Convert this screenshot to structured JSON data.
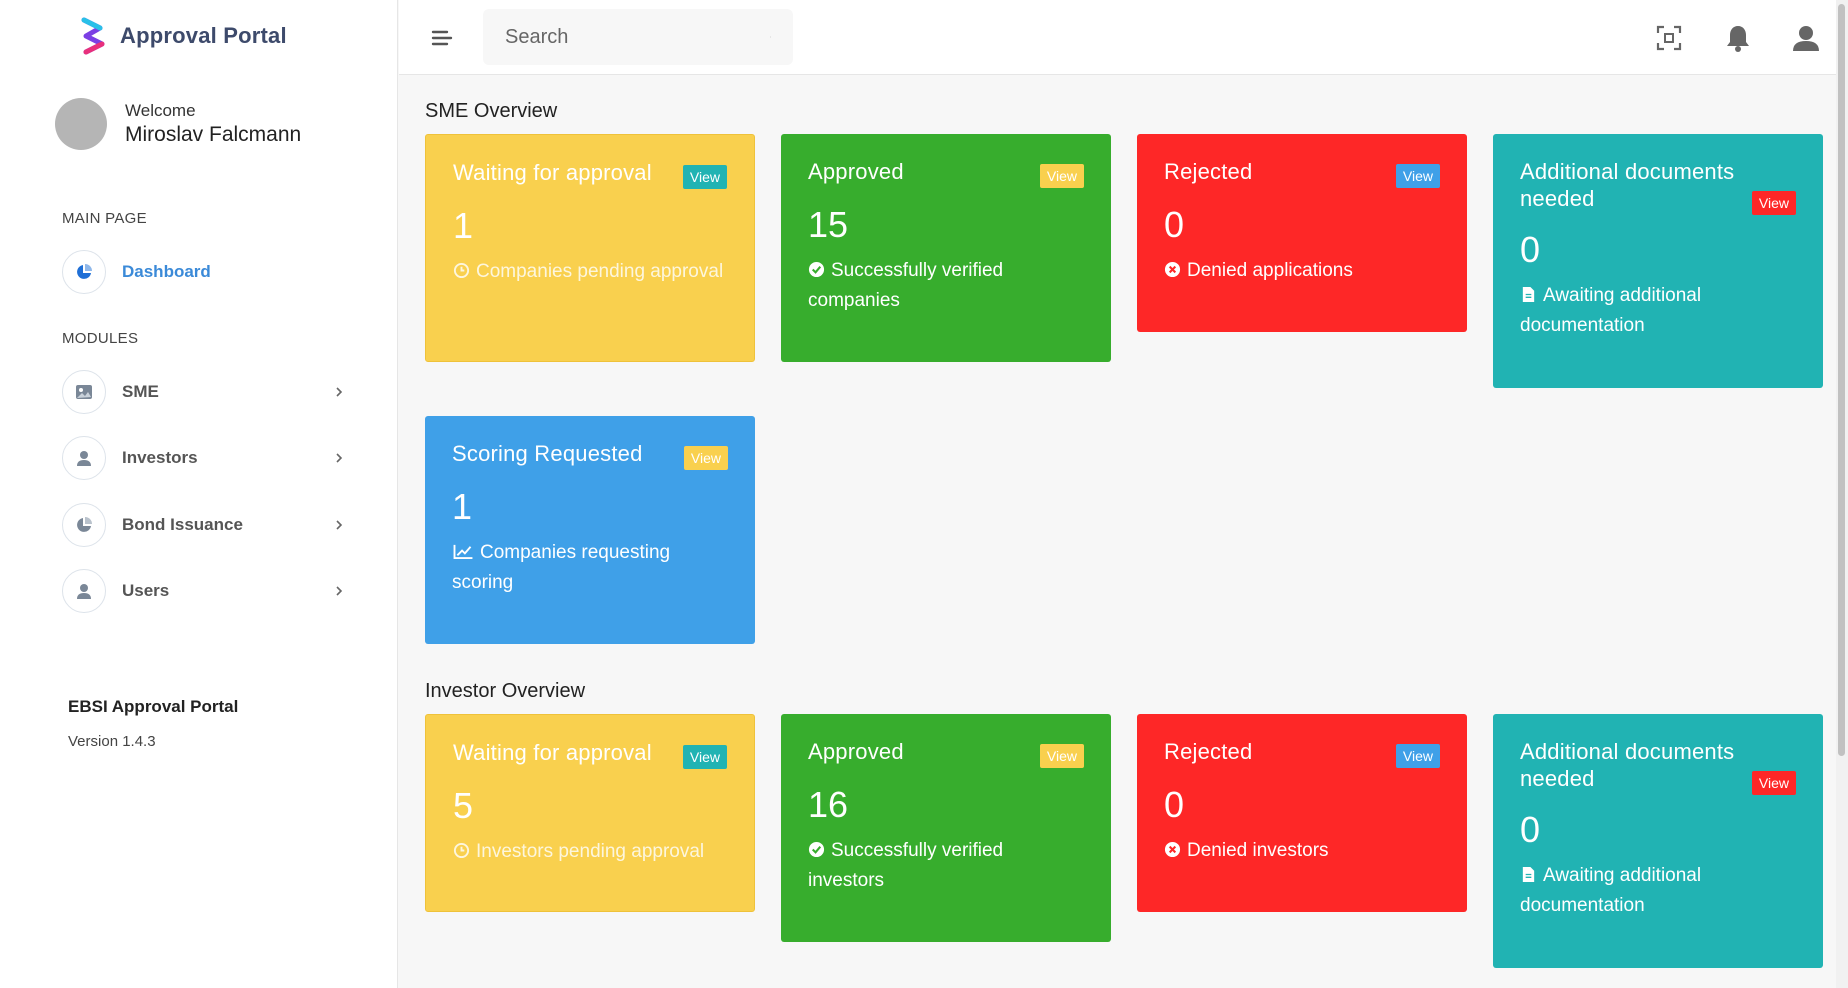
{
  "brand": {
    "name": "Approval Portal"
  },
  "user": {
    "welcome": "Welcome",
    "name": "Miroslav Falcmann"
  },
  "sidebar": {
    "main_label": "MAIN PAGE",
    "modules_label": "MODULES",
    "items": [
      {
        "label": "Dashboard",
        "icon": "pie-chart-icon",
        "active": true
      },
      {
        "label": "SME",
        "icon": "image-icon"
      },
      {
        "label": "Investors",
        "icon": "user-icon"
      },
      {
        "label": "Bond Issuance",
        "icon": "pie-chart-icon"
      },
      {
        "label": "Users",
        "icon": "user-icon"
      }
    ],
    "footer_title": "EBSI Approval Portal",
    "footer_version": "Version 1.4.3"
  },
  "topbar": {
    "search_placeholder": "Search"
  },
  "colors": {
    "yellow": "#f9d04e",
    "green": "#37ad2d",
    "red": "#fe2727",
    "teal": "#21b3b3",
    "blue": "#3fa0e8",
    "active": "#3b8ad8"
  },
  "sme": {
    "title": "SME Overview",
    "waiting": {
      "title": "Waiting for approval",
      "view": "View",
      "value": "1",
      "desc": "Companies pending approval"
    },
    "approved": {
      "title": "Approved",
      "view": "View",
      "value": "15",
      "desc": "Successfully verified companies"
    },
    "rejected": {
      "title": "Rejected",
      "view": "View",
      "value": "0",
      "desc": "Denied applications"
    },
    "additional": {
      "title": "Additional documents needed",
      "view": "View",
      "value": "0",
      "desc": "Awaiting additional documentation"
    },
    "scoring": {
      "title": "Scoring Requested",
      "view": "View",
      "value": "1",
      "desc": "Companies requesting scoring"
    }
  },
  "investor": {
    "title": "Investor Overview",
    "waiting": {
      "title": "Waiting for approval",
      "view": "View",
      "value": "5",
      "desc": "Investors pending approval"
    },
    "approved": {
      "title": "Approved",
      "view": "View",
      "value": "16",
      "desc": "Successfully verified investors"
    },
    "rejected": {
      "title": "Rejected",
      "view": "View",
      "value": "0",
      "desc": "Denied investors"
    },
    "additional": {
      "title": "Additional documents needed",
      "view": "View",
      "value": "0",
      "desc": "Awaiting additional documentation"
    }
  }
}
